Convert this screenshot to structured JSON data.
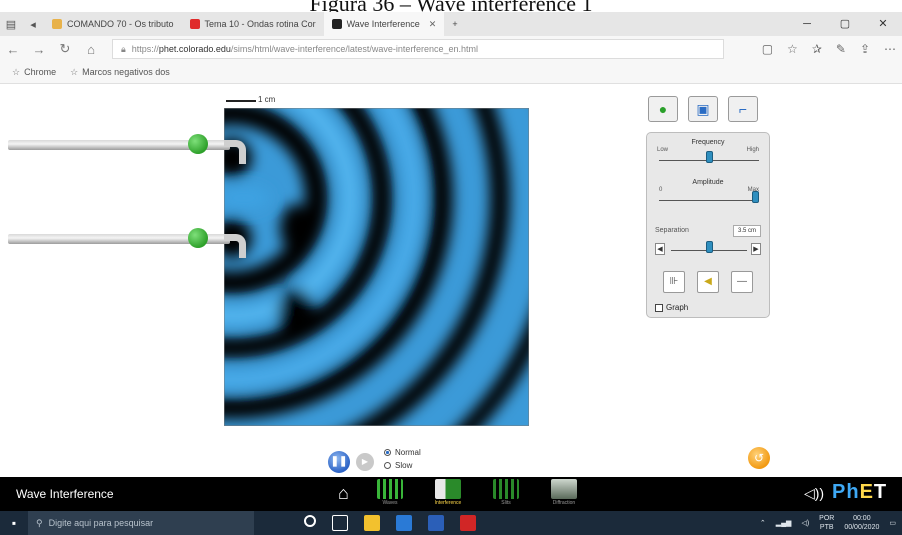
{
  "caption": "Figura 36 – Wave interference 1",
  "browser": {
    "tabs": [
      {
        "label": "COMANDO 70 - Os tributo",
        "color": "#e8b24a"
      },
      {
        "label": "Tema 10 - Ondas rotina Cor",
        "color": "#e02b2b"
      },
      {
        "label": "Wave Interference",
        "color": "#222222",
        "active": true
      }
    ],
    "new_tab_label": "+",
    "url_prefix": "https://",
    "url_host": "phet.colorado.edu",
    "url_path": "/sims/html/wave-interference/latest/wave-interference_en.html",
    "bookmarks": [
      "Chrome",
      "Marcos negativos dos"
    ]
  },
  "sim": {
    "scale_label": "1 cm",
    "controls": {
      "frequency_label": "Frequency",
      "frequency_min": "Low",
      "frequency_max": "High",
      "frequency_value": 0.5,
      "amplitude_label": "Amplitude",
      "amplitude_min": "0",
      "amplitude_max": "Max",
      "amplitude_value": 1.0,
      "separation_label": "Separation",
      "separation_value": "3.5 cm",
      "separation_level": 0.5,
      "graph_label": "Graph"
    },
    "playback": {
      "normal_label": "Normal",
      "slow_label": "Slow",
      "selected": "Normal"
    }
  },
  "navbar": {
    "title": "Wave Interference",
    "screens": [
      {
        "label": "Waves",
        "color": "#2a8a2a"
      },
      {
        "label": "Interference",
        "color": "#7a7a7a",
        "selected": true
      },
      {
        "label": "Slits",
        "color": "#2a8a2a"
      },
      {
        "label": "Diffraction",
        "color": "#5a6a5a"
      }
    ],
    "brand": "PhET"
  },
  "taskbar": {
    "search_placeholder": "Digite aqui para pesquisar",
    "lang": "POR",
    "lang2": "PTB",
    "time": "00:00",
    "date": "00/00/2020"
  }
}
